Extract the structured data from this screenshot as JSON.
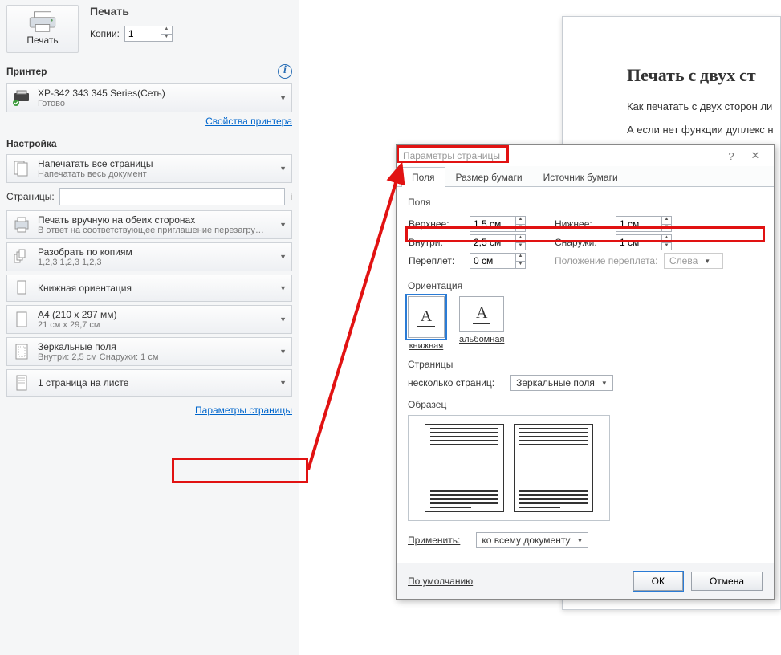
{
  "left": {
    "print": "Печать",
    "head_title": "Печать",
    "copies_label": "Копии:",
    "copies_value": "1",
    "printer_sec": "Принтер",
    "printer_name": "XP-342 343 345 Series(Сеть)",
    "printer_status": "Готово",
    "printer_props": "Свойства принтера",
    "settings_sec": "Настройка",
    "opt_allpages_t": "Напечатать все страницы",
    "opt_allpages_s": "Напечатать весь документ",
    "pages_label": "Страницы:",
    "opt_manual_t": "Печать вручную на обеих сторонах",
    "opt_manual_s": "В ответ на соответствующее приглашение перезагру…",
    "opt_collate_t": "Разобрать по копиям",
    "opt_collate_s": "1,2,3    1,2,3    1,2,3",
    "opt_orient_t": "Книжная ориентация",
    "opt_paper_t": "A4 (210 x 297 мм)",
    "opt_paper_s": "21 см x 29,7 см",
    "opt_mirror_t": "Зеркальные поля",
    "opt_mirror_s": "Внутри:  2,5 см    Снаружи:  1 см",
    "opt_sheet_t": "1 страница на листе",
    "page_setup": "Параметры страницы"
  },
  "doc": {
    "h1": "Печать с двух ст",
    "p1": "Как печатать с двух сторон ли",
    "p2": "А если нет функции дуплекс н"
  },
  "dlg": {
    "title": "Параметры страницы",
    "tab_fields": "Поля",
    "tab_paper": "Размер бумаги",
    "tab_source": "Источник бумаги",
    "grp_fields": "Поля",
    "top_lbl": "Верхнее:",
    "top_val": "1,5 см",
    "bottom_lbl": "Нижнее:",
    "bottom_val": "1 см",
    "inside_lbl": "Внутри:",
    "inside_val": "2,5 см",
    "outside_lbl": "Снаружи:",
    "outside_val": "1 см",
    "gutter_lbl": "Переплет:",
    "gutter_val": "0 см",
    "gutter_pos_lbl": "Положение переплета:",
    "gutter_pos_val": "Слева",
    "grp_orient": "Ориентация",
    "orient_port": "книжная",
    "orient_land": "альбомная",
    "grp_pages": "Страницы",
    "multi_lbl": "несколько страниц:",
    "multi_val": "Зеркальные поля",
    "grp_sample": "Образец",
    "apply_lbl": "Применить:",
    "apply_val": "ко всему документу",
    "default_btn": "По умолчанию",
    "ok": "ОК",
    "cancel": "Отмена"
  }
}
